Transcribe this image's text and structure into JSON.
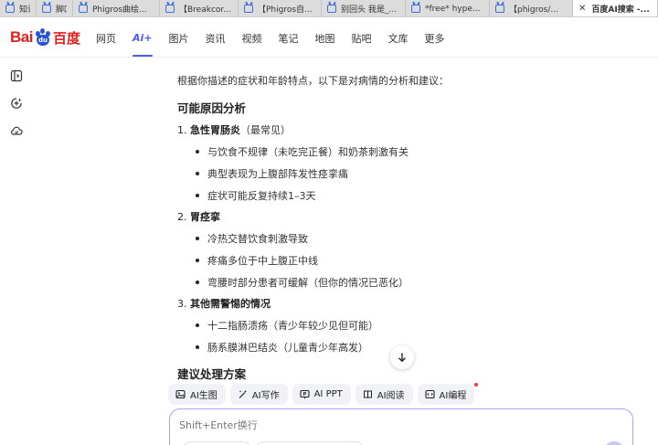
{
  "tabs": [
    {
      "label": "知识"
    },
    {
      "label": "脚吅"
    },
    {
      "label": "Phigros曲绘..."
    },
    {
      "label": "【Breakcor..."
    },
    {
      "label": "【Phigros自..."
    },
    {
      "label": "别回头 我是_..."
    },
    {
      "label": "*free* hype..."
    },
    {
      "label": "【phigros/..."
    },
    {
      "label": "百度AI搜索 -..."
    }
  ],
  "logo": {
    "bai": "Bai",
    "du": "du",
    "zh": "百度"
  },
  "nav": [
    {
      "label": "网页"
    },
    {
      "label": "Ai+"
    },
    {
      "label": "图片"
    },
    {
      "label": "资讯"
    },
    {
      "label": "视频"
    },
    {
      "label": "笔记"
    },
    {
      "label": "地图"
    },
    {
      "label": "贴吧"
    },
    {
      "label": "文库"
    },
    {
      "label": "更多"
    }
  ],
  "answer": {
    "intro": "根据你描述的症状和年龄特点，以下是对病情的分析和建议：",
    "section1_title": "可能原因分析",
    "items": [
      {
        "num": "1.",
        "title": "急性胃肠炎",
        "note": "（最常见）",
        "bullets": [
          "与饮食不规律（未吃完正餐）和奶茶刺激有关",
          "典型表现为上腹部阵发性痉挛痛",
          "症状可能反复持续1–3天"
        ]
      },
      {
        "num": "2.",
        "title": "胃痉挛",
        "note": "",
        "bullets": [
          "冷热交替饮食刺激导致",
          "疼痛多位于中上腹正中线",
          "弯腰时部分患者可缓解（但你的情况已恶化）"
        ]
      },
      {
        "num": "3.",
        "title": "其他需警惕的情况",
        "note": "",
        "bullets": [
          "十二指肠溃疡（青少年较少见但可能）",
          "肠系膜淋巴结炎（儿童青少年高发）"
        ]
      }
    ],
    "section2_title": "建议处理方案"
  },
  "tools": [
    {
      "label": "AI生图",
      "icon": "image-icon"
    },
    {
      "label": "AI写作",
      "icon": "magic-pen-icon"
    },
    {
      "label": "AI PPT",
      "icon": "ppt-icon"
    },
    {
      "label": "AI阅读",
      "icon": "book-icon"
    },
    {
      "label": "AI编程",
      "icon": "code-icon"
    }
  ],
  "input": {
    "placeholder": "Shift+Enter换行"
  },
  "colors": {
    "accent": "#4a5bf0",
    "brand_red": "#e02020",
    "brand_blue": "#2b52d6",
    "input_border": "#a9a3f2"
  }
}
